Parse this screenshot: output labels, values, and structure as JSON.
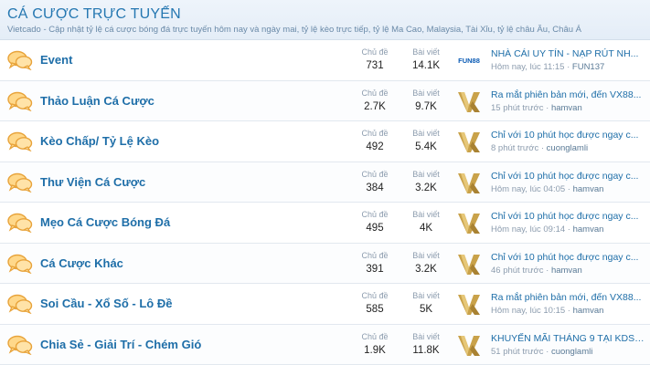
{
  "header": {
    "title": "CÁ CƯỢC TRỰC TUYẾN",
    "description": "Vietcado - Cập nhật tỷ lệ cá cược bóng đá trực tuyến hôm nay và ngày mai, tỷ lệ kèo trực tiếp, tỷ lệ Ma Cao, Malaysia, Tài Xỉu, tỷ lệ châu Âu, Châu Á"
  },
  "labels": {
    "topics": "Chủ đề",
    "posts": "Bài viết"
  },
  "forums": [
    {
      "name": "Event",
      "topics": "731",
      "posts": "14.1K",
      "avatar": "fun88",
      "last_title": "NHÀ CÁI UY TÍN - NẠP RÚT NH...",
      "last_time": "Hôm nay, lúc 11:15",
      "last_user": "FUN137"
    },
    {
      "name": "Thảo Luận Cá Cược",
      "topics": "2.7K",
      "posts": "9.7K",
      "avatar": "vx88",
      "last_title": "Ra mắt phiên bản mới, đến VX88...",
      "last_time": "15 phút trước",
      "last_user": "hamvan"
    },
    {
      "name": "Kèo Chấp/ Tỷ Lệ Kèo",
      "topics": "492",
      "posts": "5.4K",
      "avatar": "vx88",
      "last_title": "Chỉ với 10 phút học được ngay c...",
      "last_time": "8 phút trước",
      "last_user": "cuonglamli"
    },
    {
      "name": "Thư Viện Cá Cược",
      "topics": "384",
      "posts": "3.2K",
      "avatar": "vx88",
      "last_title": "Chỉ với 10 phút học được ngay c...",
      "last_time": "Hôm nay, lúc 04:05",
      "last_user": "hamvan"
    },
    {
      "name": "Mẹo Cá Cược Bóng Đá",
      "topics": "495",
      "posts": "4K",
      "avatar": "vx88",
      "last_title": "Chỉ với 10 phút học được ngay c...",
      "last_time": "Hôm nay, lúc 09:14",
      "last_user": "hamvan"
    },
    {
      "name": "Cá Cược Khác",
      "topics": "391",
      "posts": "3.2K",
      "avatar": "vx88",
      "last_title": "Chỉ với 10 phút học được ngay c...",
      "last_time": "46 phút trước",
      "last_user": "hamvan"
    },
    {
      "name": "Soi Cầu - Xổ Số - Lô Đề",
      "topics": "585",
      "posts": "5K",
      "avatar": "vx88",
      "last_title": "Ra mắt phiên bản mới, đến VX88...",
      "last_time": "Hôm nay, lúc 10:15",
      "last_user": "hamvan"
    },
    {
      "name": "Chia Sẻ - Giải Trí - Chém Gió",
      "topics": "1.9K",
      "posts": "11.8K",
      "avatar": "vx88",
      "last_title": "KHUYẾN MÃI THÁNG 9 TẠI KDSL...",
      "last_time": "51 phút trước",
      "last_user": "cuonglamli"
    }
  ],
  "colors": {
    "title": "#2577b1",
    "link": "#1e6ea8",
    "forum_icon": "#e8a33a",
    "avatar_gold": "#c9a24a"
  },
  "icons": {
    "forum": "speech-bubbles-icon"
  },
  "avatar_texts": {
    "fun88": "FUN88"
  }
}
